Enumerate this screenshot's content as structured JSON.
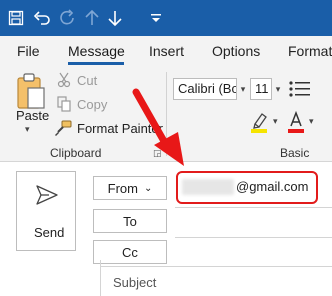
{
  "quick_access": {
    "icons": [
      "save-icon",
      "undo-icon",
      "redo-icon",
      "up-arrow-icon",
      "down-arrow-icon",
      "customize-quick-access-icon"
    ]
  },
  "tabs": [
    {
      "label": "File"
    },
    {
      "label": "Message"
    },
    {
      "label": "Insert"
    },
    {
      "label": "Options"
    },
    {
      "label": "Format"
    }
  ],
  "ribbon": {
    "clipboard": {
      "paste": "Paste",
      "cut": "Cut",
      "copy": "Copy",
      "format_painter": "Format Painter",
      "group_label": "Clipboard"
    },
    "basic_text": {
      "font_name": "Calibri (Boc",
      "font_size": "11",
      "group_label": "Basic Text",
      "highlight_color": "#f5e400",
      "font_color": "#e81818"
    }
  },
  "compose": {
    "send": "Send",
    "from": "From",
    "to": "To",
    "cc": "Cc",
    "from_email": "@gmail.com",
    "subject": "Subject"
  },
  "colors": {
    "titlebar": "#1a5ea8",
    "ribbon_bg": "#f3f3f3",
    "highlight_border": "#e21b1b",
    "annotation_arrow": "#e81818"
  }
}
